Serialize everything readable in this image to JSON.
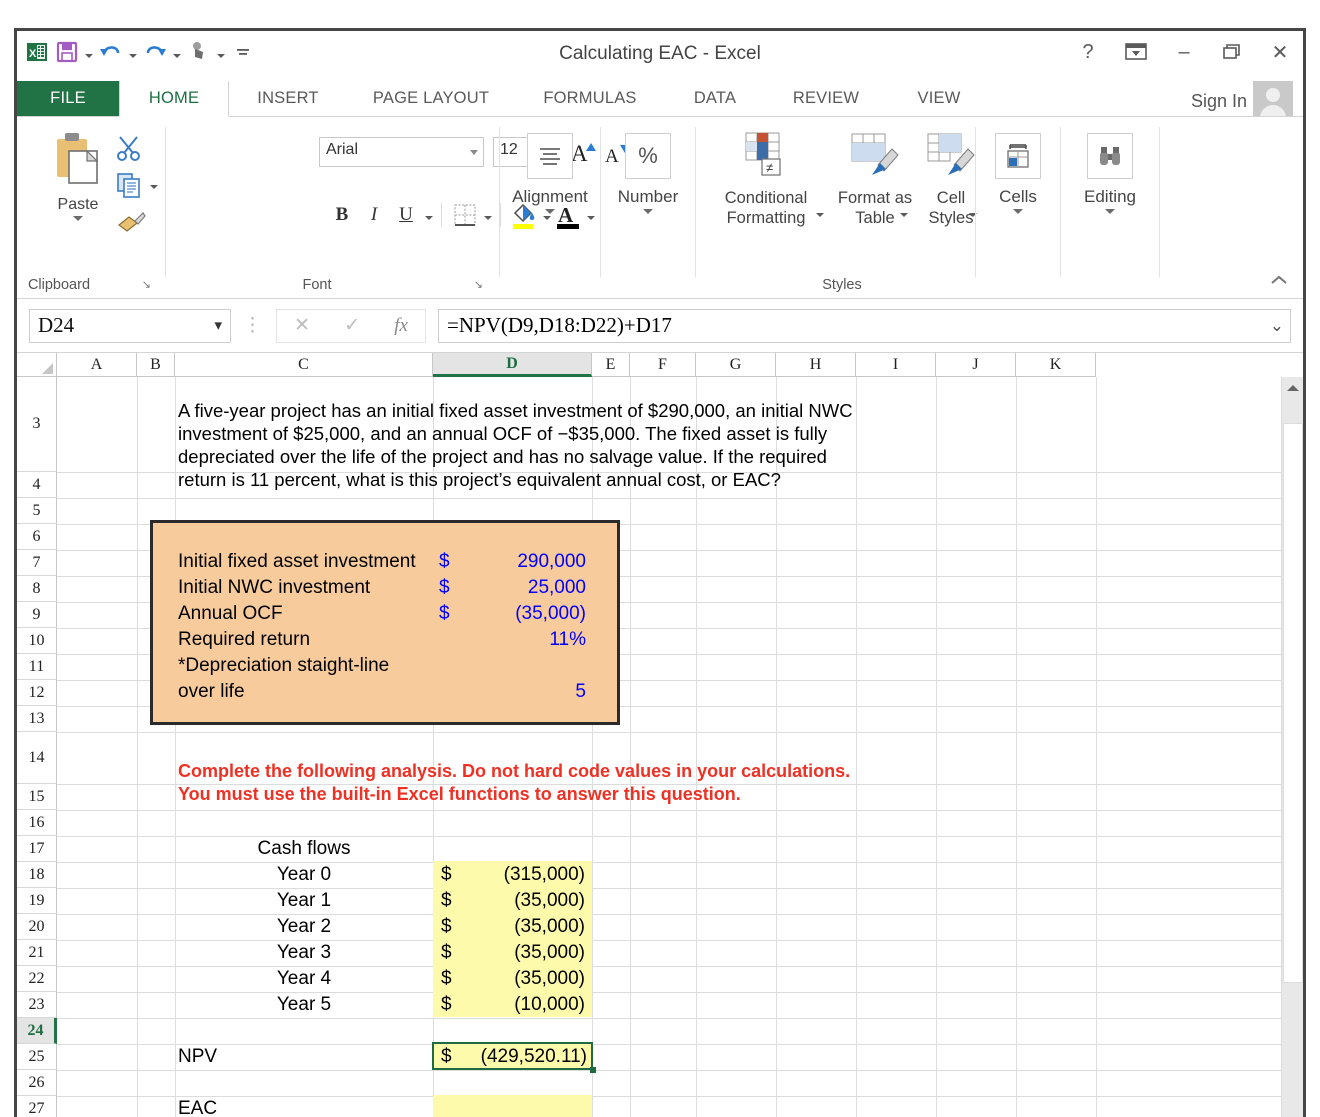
{
  "window": {
    "title": "Calculating EAC - Excel",
    "help_icon": "?",
    "ribbon_display_icon": "ribbon-display-options-icon",
    "minimize_icon": "–",
    "restore_icon": "restore-icon",
    "close_icon": "✕",
    "sign_in": "Sign In"
  },
  "quick_access": {
    "app_icon": "excel-app-icon",
    "save_icon": "save-icon",
    "undo_icon": "undo-icon",
    "redo_icon": "redo-icon",
    "touch_icon": "touch-mode-icon",
    "customize_icon": "customize-qat-icon"
  },
  "tabs": [
    {
      "label": "FILE",
      "active": false,
      "file": true
    },
    {
      "label": "HOME",
      "active": true
    },
    {
      "label": "INSERT",
      "active": false
    },
    {
      "label": "PAGE LAYOUT",
      "active": false
    },
    {
      "label": "FORMULAS",
      "active": false
    },
    {
      "label": "DATA",
      "active": false
    },
    {
      "label": "REVIEW",
      "active": false
    },
    {
      "label": "VIEW",
      "active": false
    }
  ],
  "ribbon": {
    "clipboard": {
      "group_label": "Clipboard",
      "paste_label": "Paste",
      "cut_icon": "scissors-icon",
      "copy_icon": "copy-icon",
      "format_painter_icon": "format-painter-icon",
      "dialog_launcher": "↘"
    },
    "font": {
      "group_label": "Font",
      "font_name": "Arial",
      "font_size": "12",
      "grow_font": "A",
      "shrink_font": "A",
      "bold": "B",
      "italic": "I",
      "underline": "U",
      "borders_icon": "borders-icon",
      "fill_color_icon": "fill-color-icon",
      "font_color": "A",
      "dialog_launcher": "↘"
    },
    "alignment": {
      "group_label": "Alignment",
      "icon": "alignment-icon"
    },
    "number": {
      "group_label": "Number",
      "icon": "percent-icon",
      "glyph": "%"
    },
    "styles": {
      "group_label": "Styles",
      "conditional_formatting": "Conditional\nFormatting",
      "format_as_table": "Format as\nTable",
      "cell_styles": "Cell\nStyles"
    },
    "cells": {
      "group_label": "Cells",
      "caption": "Cells",
      "icon": "cells-icon"
    },
    "editing": {
      "group_label": "Editing",
      "caption": "Editing",
      "icon": "find-binoculars-icon"
    },
    "collapse_icon": "⌃"
  },
  "formula_bar": {
    "name_box": "D24",
    "cancel_icon": "✕",
    "enter_icon": "✓",
    "insert_function_icon": "fx",
    "formula": "=NPV(D9,D18:D22)+D17",
    "expand_icon": "⌄"
  },
  "sheet": {
    "columns": [
      "A",
      "B",
      "C",
      "D",
      "E",
      "F",
      "G",
      "H",
      "I",
      "J",
      "K"
    ],
    "selected_column": "D",
    "rows": [
      "3",
      "4",
      "5",
      "6",
      "7",
      "8",
      "9",
      "10",
      "11",
      "12",
      "13",
      "14",
      "15",
      "16",
      "17",
      "18",
      "19",
      "20",
      "21",
      "22",
      "23",
      "24",
      "25",
      "26",
      "27"
    ],
    "selected_row": "24",
    "question_text": "A five-year project has an initial fixed asset investment of $290,000, an initial NWC\ninvestment of $25,000, and an annual OCF of −$35,000. The fixed asset is fully\ndepreciated over the life of the project and has no salvage value. If the required\nreturn is 11 percent, what is this project’s equivalent annual cost, or EAC?",
    "inputs_box": [
      {
        "label": "Initial fixed asset investment",
        "currency": "$",
        "value": "290,000"
      },
      {
        "label": "Initial NWC investment",
        "currency": "$",
        "value": "25,000"
      },
      {
        "label": "Annual OCF",
        "currency": "$",
        "value": "(35,000)"
      },
      {
        "label": "Required return",
        "currency": "",
        "value": "11%"
      },
      {
        "label": "*Depreciation staight-line",
        "currency": "",
        "value": ""
      },
      {
        "label": "over life",
        "currency": "",
        "value": "5"
      }
    ],
    "instruction_text": "Complete the following analysis. Do not hard code values in your calculations.\nYou must use the built-in Excel functions to answer this question.",
    "cash_flows_header": "Cash flows",
    "cash_flows": [
      {
        "label": "Year 0",
        "currency": "$",
        "value": "(315,000)"
      },
      {
        "label": "Year 1",
        "currency": "$",
        "value": "(35,000)"
      },
      {
        "label": "Year 2",
        "currency": "$",
        "value": "(35,000)"
      },
      {
        "label": "Year 3",
        "currency": "$",
        "value": "(35,000)"
      },
      {
        "label": "Year 4",
        "currency": "$",
        "value": "(35,000)"
      },
      {
        "label": "Year 5",
        "currency": "$",
        "value": "(10,000)"
      }
    ],
    "npv_label": "NPV",
    "npv_currency": "$",
    "npv_value": "(429,520.11)",
    "eac_label": "EAC",
    "eac_value": ""
  },
  "colors": {
    "excel_green": "#217346",
    "input_box_fill": "#f7cb9c",
    "answer_fill": "#fdfbab",
    "instruction_red": "#ef3124",
    "input_value_blue": "#0000ff",
    "selection_green": "#1e6b41"
  }
}
